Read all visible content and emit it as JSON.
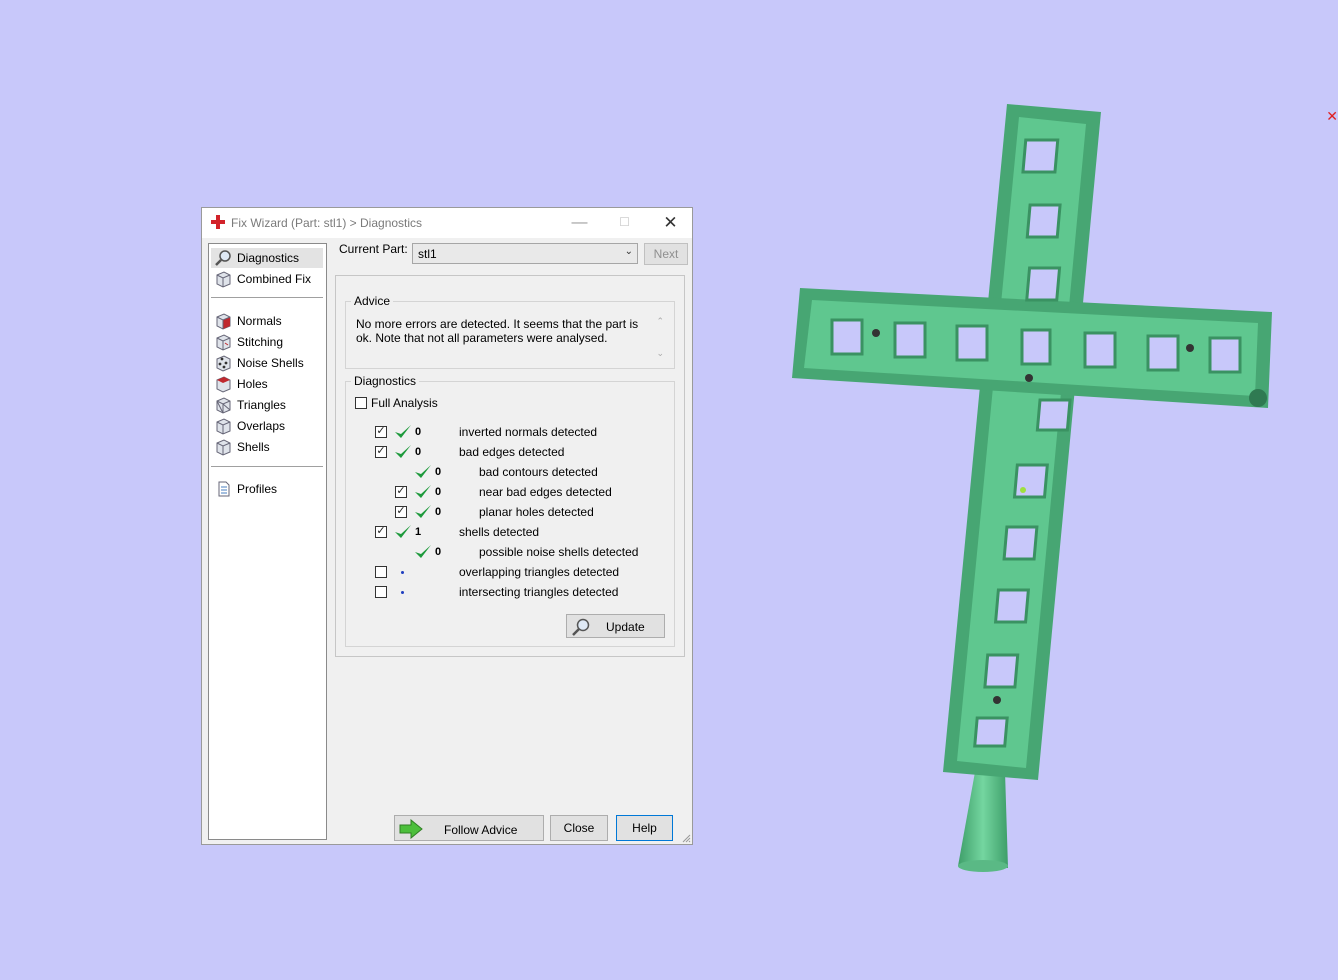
{
  "window": {
    "title": "Fix Wizard (Part: stl1) > Diagnostics",
    "minimize_glyph": "—",
    "maximize_glyph": "☐",
    "close_glyph": "✕"
  },
  "nav": {
    "items": [
      {
        "label": "Diagnostics",
        "icon": "magnifier-icon"
      },
      {
        "label": "Combined Fix",
        "icon": "cube-icon"
      },
      {
        "label": "Normals",
        "icon": "cube-icon"
      },
      {
        "label": "Stitching",
        "icon": "cube-icon"
      },
      {
        "label": "Noise Shells",
        "icon": "cube-icon"
      },
      {
        "label": "Holes",
        "icon": "cube-icon"
      },
      {
        "label": "Triangles",
        "icon": "cube-icon"
      },
      {
        "label": "Overlaps",
        "icon": "cube-icon"
      },
      {
        "label": "Shells",
        "icon": "cube-icon"
      },
      {
        "label": "Profiles",
        "icon": "document-icon"
      }
    ],
    "active": "Diagnostics"
  },
  "current_part": {
    "label": "Current Part:",
    "value": "stl1",
    "next_label": "Next"
  },
  "advice": {
    "title": "Advice",
    "text": "No more errors are detected. It seems that the part is ok. Note that not all parameters were analysed."
  },
  "diagnostics": {
    "title": "Diagnostics",
    "full_analysis_label": "Full Analysis",
    "rows": [
      {
        "checkbox": true,
        "checked": true,
        "status": "ok",
        "count": "0",
        "label": "inverted normals detected"
      },
      {
        "checkbox": true,
        "checked": true,
        "status": "ok",
        "count": "0",
        "label": "bad edges detected"
      },
      {
        "checkbox": false,
        "checked": false,
        "status": "ok",
        "count": "0",
        "label": "bad contours detected"
      },
      {
        "checkbox": true,
        "checked": true,
        "status": "ok",
        "count": "0",
        "label": "near bad edges detected"
      },
      {
        "checkbox": true,
        "checked": true,
        "status": "ok",
        "count": "0",
        "label": "planar holes detected"
      },
      {
        "checkbox": true,
        "checked": true,
        "status": "ok",
        "count": "1",
        "label": "shells detected"
      },
      {
        "checkbox": false,
        "checked": false,
        "status": "ok",
        "count": "0",
        "label": "possible noise shells detected"
      },
      {
        "checkbox": true,
        "checked": false,
        "status": "not-run",
        "count": "",
        "label": "overlapping triangles detected"
      },
      {
        "checkbox": true,
        "checked": false,
        "status": "not-run",
        "count": "",
        "label": "intersecting triangles detected"
      }
    ],
    "update_label": "Update"
  },
  "footer": {
    "follow_advice_label": "Follow Advice",
    "close_label": "Close",
    "help_label": "Help"
  },
  "colors": {
    "background": "#c8c8fa",
    "model": "#5cc08a",
    "check_green": "#1e9a3c"
  }
}
